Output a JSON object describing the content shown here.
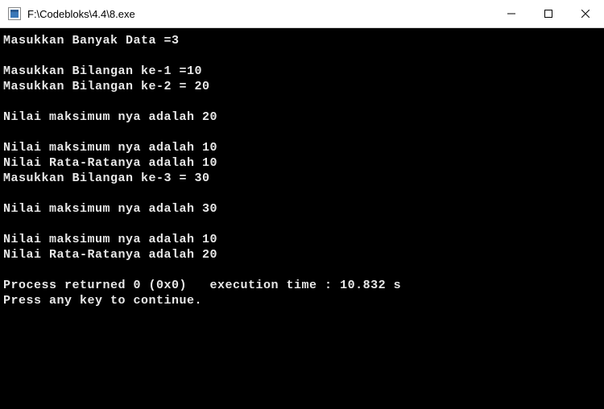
{
  "window": {
    "title": "F:\\Codebloks\\4.4\\8.exe"
  },
  "console": {
    "lines": [
      "Masukkan Banyak Data =3",
      "",
      "Masukkan Bilangan ke-1 =10",
      "Masukkan Bilangan ke-2 = 20",
      "",
      "Nilai maksimum nya adalah 20",
      "",
      "Nilai maksimum nya adalah 10",
      "Nilai Rata-Ratanya adalah 10",
      "Masukkan Bilangan ke-3 = 30",
      "",
      "Nilai maksimum nya adalah 30",
      "",
      "Nilai maksimum nya adalah 10",
      "Nilai Rata-Ratanya adalah 20",
      "",
      "Process returned 0 (0x0)   execution time : 10.832 s",
      "Press any key to continue."
    ]
  }
}
